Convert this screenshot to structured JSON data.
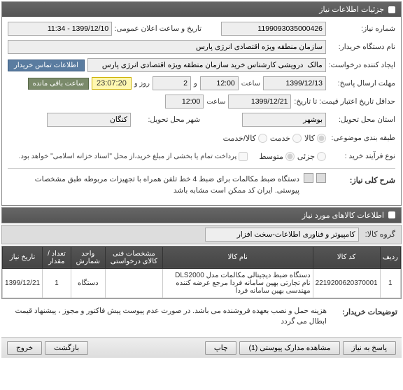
{
  "panel1_title": "جزئیات اطلاعات نیاز",
  "f": {
    "need_no_label": "شماره نیاز:",
    "need_no": "1199093035000426",
    "pub_date_label": "تاریخ و ساعت اعلان عمومی:",
    "pub_date": "1399/12/10 - 11:34",
    "buyer_label": "نام دستگاه خریدار:",
    "buyer": "سازمان منطقه ویژه اقتصادی انرژی پارس",
    "creator_label": "ایجاد کننده درخواست:",
    "creator": "مالک  درویشی کارشناس خرید سازمان منطقه ویژه اقتصادی انرژی پارس",
    "contact_btn": "اطلاعات تماس خریدار",
    "deadline_label": "مهلت ارسال پاسخ:",
    "deadline_date": "1399/12/13",
    "deadline_hour": "12:00",
    "deadline_and": "و",
    "deadline_days": "2",
    "deadline_days_unit": "روز و",
    "deadline_time_left": "23:07:20",
    "deadline_remain": "ساعت باقی مانده",
    "hour_lbl": "ساعت",
    "validity_label": "حداقل تاریخ اعتبار قیمت: تا تاریخ:",
    "validity_date": "1399/12/21",
    "validity_hour": "12:00",
    "delivery_state_label": "استان محل تحویل:",
    "delivery_state": "بوشهر",
    "delivery_city_label": "شهر محل تحویل:",
    "delivery_city": "کنگان",
    "category_label": "طبقه بندی موضوعی:",
    "cat_goods": "کالا",
    "cat_service": "خدمت",
    "cat_goods_service": "کالا/خدمت",
    "process_label": "نوع فرآیند خرید :",
    "proc_small": "جزئی",
    "proc_medium": "متوسط",
    "partial_pay": "پرداخت تمام یا بخشی از مبلغ خرید،از محل \"اسناد خزانه اسلامی\" خواهد بود.",
    "desc_label": "شرح کلی نیاز:",
    "desc_text": "دستگاه ضبط مکالمات برای ضبط 4 خط تلفن همراه با تجهیزات مربوطه طبق مشخصات پیوستی. ایران کد ممکن است مشابه باشد"
  },
  "panel2_title": "اطلاعات کالاهای مورد نیاز",
  "group_label": "گروه کالا:",
  "group_value": "کامپیوتر و فناوری اطلاعات-سخت افزار",
  "table": {
    "headers": [
      "ردیف",
      "کد کالا",
      "نام کالا",
      "مشخصات فنی کالای درخواستی",
      "واحد شمارش",
      "تعداد / مقدار",
      "تاریخ نیاز"
    ],
    "row": {
      "idx": "1",
      "code": "2219200620370001",
      "name": "دستگاه ضبط دیجیتالی مکالمات مدل DLS2000 نام تجارتی بهین سامانه فردا مرجع عرضه کننده مهندسی بهین سامانه فردا",
      "spec": "",
      "unit": "دستگاه",
      "qty": "1",
      "date": "1399/12/21"
    }
  },
  "buyer_notes_label": "توضیحات خریدار:",
  "buyer_notes": "هزینه حمل و نصب بعهده فروشنده می باشد. در صورت عدم پیوست پیش فاکتور و مجوز ، پیشنهاد قیمت ابطال می گردد",
  "footer": {
    "respond": "پاسخ به نیاز",
    "attachments": "مشاهده مدارک پیوستی (1)",
    "print": "چاپ",
    "back": "بازگشت",
    "exit": "خروج"
  }
}
